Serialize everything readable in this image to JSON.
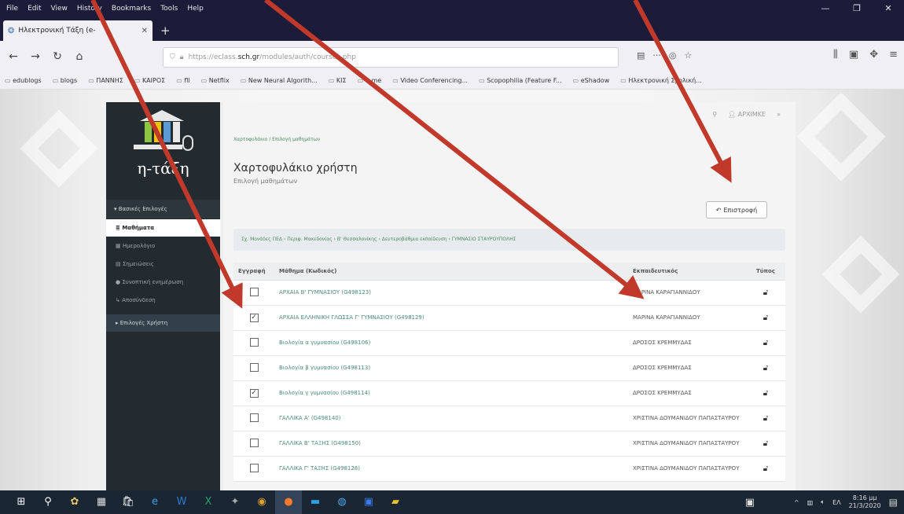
{
  "browser": {
    "menu": [
      "File",
      "Edit",
      "View",
      "History",
      "Bookmarks",
      "Tools",
      "Help"
    ],
    "tab_title": "Ηλεκτρονική Τάξη (e-",
    "url_prefix": "https://eclass.",
    "url_domain": "sch.gr",
    "url_path": "/modules/auth/courses.php",
    "bookmarks": [
      "edublogs",
      "blogs",
      "ΠΑΝΝΗΣ",
      "ΚΑΙΡΟΣ",
      "fll",
      "Netflix",
      "New Neural Algorith...",
      "ΚΙΣ",
      "e-me",
      "Video Conferencing...",
      "Scopophilia (Feature F...",
      "eShadow",
      "Ηλεκτρονική Σχολική..."
    ]
  },
  "sidebar": {
    "brand": "η-τάξη",
    "menu_header": "Βασικές Επιλογές",
    "items": [
      {
        "label": "Μαθήματα",
        "active": true
      },
      {
        "label": "Ημερολόγιο",
        "active": false
      },
      {
        "label": "Σημειώσεις",
        "active": false
      },
      {
        "label": "Συνοπτική ενημέρωση",
        "active": false
      },
      {
        "label": "Αποσύνδεση",
        "active": false
      }
    ],
    "group": "Επιλογές Χρήστη"
  },
  "header": {
    "user": "ΑΡΧΙΜΚΕ"
  },
  "main": {
    "breadcrumb": "Χαρτοφυλάκιο / Επιλογή μαθημάτων",
    "title": "Χαρτοφυλάκιο χρήστη",
    "subtitle": "Επιλογή μαθημάτων",
    "back_button": "Επιστροφή",
    "info_path": "Σχ. Μονάδες ΠΕΔ › Περιφ. Μακεδονίας › Β' Θεσσαλονίκης › Δευτεροβάθμια εκπαίδευση › ΓΥΜΝΑΣΙΟ ΣΤΑΥΡΟΥΠΟΛΗΣ",
    "table": {
      "headers": [
        "Εγγραφή",
        "Μάθημα (Κωδικός)",
        "Εκπαιδευτικός",
        "Τύπος"
      ],
      "rows": [
        {
          "checked": false,
          "course": "ΑΡΧΑΙΑ Β' ΓΥΜΝΑΣΙΟΥ (G498123)",
          "teacher": "ΜΑΡΙΝΑ ΚΑΡΑΓΙΑΝΝΙΔΟΥ"
        },
        {
          "checked": true,
          "course": "ΑΡΧΑΙΑ ΕΛΛΗΝΙΚΗ ΓΛΩΣΣΑ Γ' ΓΥΜΝΑΣΙΟΥ (G498129)",
          "teacher": "ΜΑΡΙΝΑ ΚΑΡΑΓΙΑΝΝΙΔΟΥ"
        },
        {
          "checked": false,
          "course": "Βιολογία α γυμνασίου (G498106)",
          "teacher": "ΔΡΟΣΟΣ ΚΡΕΜΜΥΔΑΣ"
        },
        {
          "checked": false,
          "course": "Βιολογία β γυμνασίου (G498113)",
          "teacher": "ΔΡΟΣΟΣ ΚΡΕΜΜΥΔΑΣ"
        },
        {
          "checked": true,
          "course": "Βιολογία γ γυμνασίου (G498114)",
          "teacher": "ΔΡΟΣΟΣ ΚΡΕΜΜΥΔΑΣ"
        },
        {
          "checked": false,
          "course": "ΓΑΛΛΙΚΑ Α' (G498140)",
          "teacher": "ΧΡΙΣΤΙΝΑ ΔΟΥΜΑΝΙΔΟΥ ΠΑΠΑΣΤΑΥΡΟΥ"
        },
        {
          "checked": false,
          "course": "ΓΑΛΛΙΚΑ Β' ΤΑΞΗΣ (G498150)",
          "teacher": "ΧΡΙΣΤΙΝΑ ΔΟΥΜΑΝΙΔΟΥ ΠΑΠΑΣΤΑΥΡΟΥ"
        },
        {
          "checked": false,
          "course": "ΓΑΛΛΙΚΑ Γ' ΤΑΞΗΣ (G498128)",
          "teacher": "ΧΡΙΣΤΙΝΑ ΔΟΥΜΑΝΙΔΟΥ ΠΑΠΑΣΤΑΥΡΟΥ"
        }
      ]
    }
  },
  "taskbar": {
    "lang": "ΕΛ",
    "time": "8:16 μμ",
    "date": "21/3/2020"
  },
  "colors": {
    "annotation_arrow": "#c0392b",
    "sidebar_bg": "#232b30",
    "link_green": "#4a8a7a"
  }
}
